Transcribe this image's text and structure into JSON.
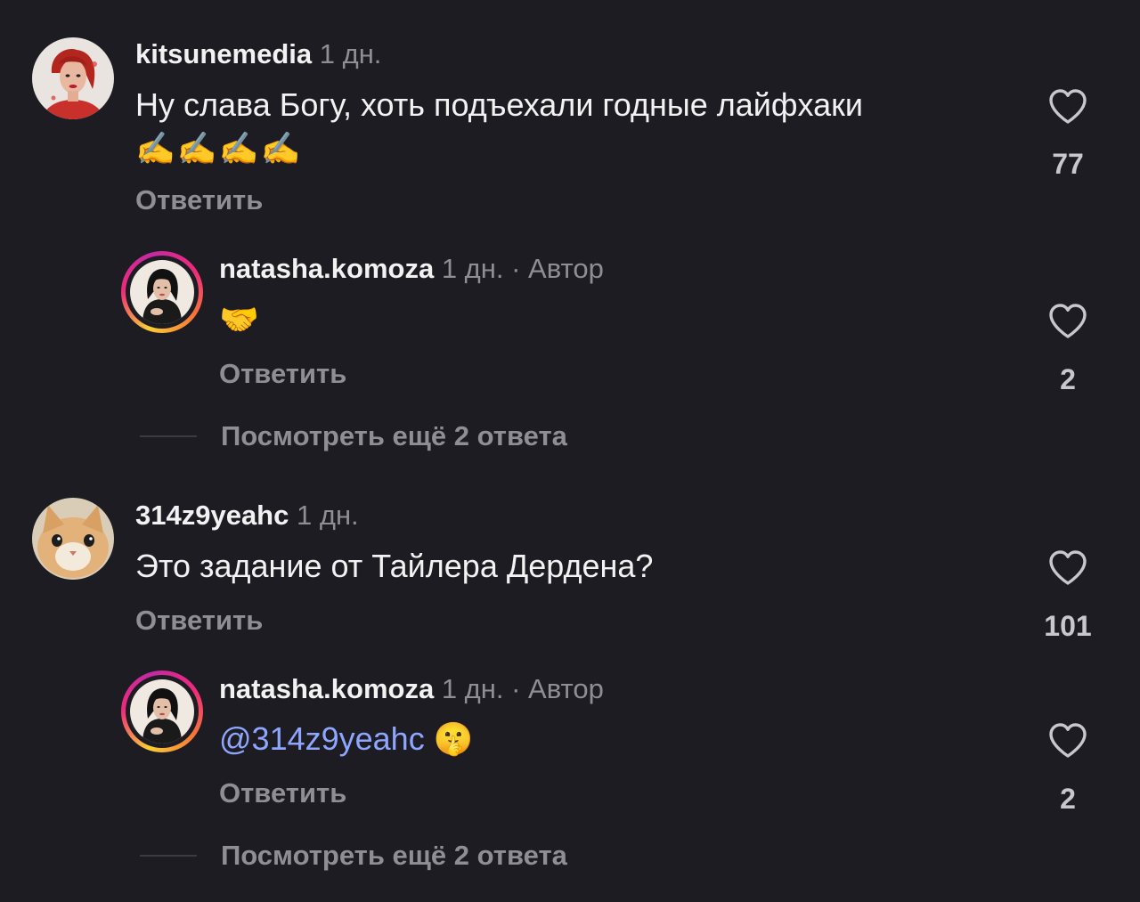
{
  "comments": [
    {
      "username": "kitsunemedia",
      "time": "1 дн.",
      "text": "Ну слава Богу, хоть подъехали годные лайфхаки",
      "emoji": "✍️✍️✍️✍️",
      "reply_label": "Ответить",
      "likes": "77",
      "avatar_icon": "woman-portrait-avatar",
      "replies": [
        {
          "username": "natasha.komoza",
          "time": "1 дн. · Автор",
          "text": "🤝",
          "reply_label": "Ответить",
          "likes": "2",
          "avatar_icon": "story-ring-avatar"
        }
      ],
      "more_replies_label": "Посмотреть ещё 2 ответа"
    },
    {
      "username": "314z9yeahc",
      "time": "1 дн.",
      "text": "Это задание от Тайлера Дердена?",
      "reply_label": "Ответить",
      "likes": "101",
      "avatar_icon": "cat-avatar",
      "replies": [
        {
          "username": "natasha.komoza",
          "time": "1 дн. · Автор",
          "mention": "@314z9yeahc",
          "emoji": "🤫",
          "reply_label": "Ответить",
          "likes": "2",
          "avatar_icon": "story-ring-avatar"
        }
      ],
      "more_replies_label": "Посмотреть ещё 2 ответа"
    }
  ],
  "colors": {
    "background": "#1c1c22",
    "text": "#f2f2f2",
    "secondary": "#8e8e93",
    "mention": "#8fa6ff",
    "story_ring": "#ee2a7b"
  }
}
